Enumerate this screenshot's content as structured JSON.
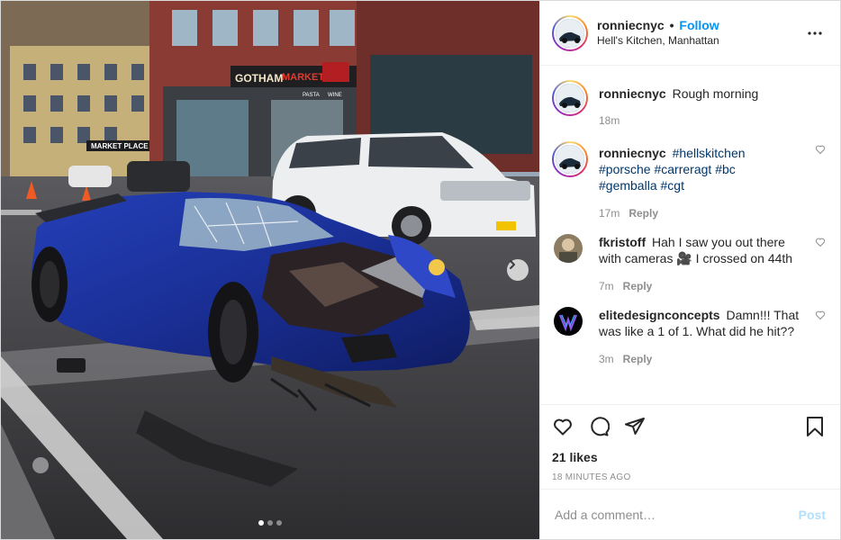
{
  "post": {
    "author": "ronniecnyc",
    "separator": "•",
    "follow_label": "Follow",
    "location": "Hell's Kitchen, Manhattan",
    "carousel_slides": 3,
    "carousel_active": 1
  },
  "photo_signs": {
    "sign_1": "GOTHAM",
    "sign_2": "MARKET",
    "sign_3": "PASTA",
    "sign_4": "WINE",
    "sign_5": "MARKET PLACE"
  },
  "comments": [
    {
      "user": "ronniecnyc",
      "text": "Rough morning",
      "time": "18m",
      "reply": ""
    },
    {
      "user": "ronniecnyc",
      "tags": [
        "#hellskitchen",
        "#porsche",
        "#carreragt",
        "#bc",
        "#gemballa",
        "#cgt"
      ],
      "time": "17m",
      "reply": "Reply"
    },
    {
      "user": "fkristoff",
      "text": "Hah I saw you out there with cameras 🎥 I crossed on 44th",
      "time": "7m",
      "reply": "Reply"
    },
    {
      "user": "elitedesignconcepts",
      "text": "Damn!!! That was like a 1 of 1. What did he hit??",
      "time": "3m",
      "reply": "Reply"
    }
  ],
  "stats": {
    "likes": "21 likes",
    "posted": "18 MINUTES AGO"
  },
  "composer": {
    "placeholder": "Add a comment…",
    "post_label": "Post"
  },
  "colors": {
    "accent": "#0095f6",
    "post_disabled": "#b2dffc",
    "tag": "#00376b",
    "muted": "#8e8e8e"
  },
  "icons": [
    "more-options-icon",
    "heart-icon",
    "comment-icon",
    "share-icon",
    "bookmark-icon",
    "chevron-right-icon"
  ]
}
